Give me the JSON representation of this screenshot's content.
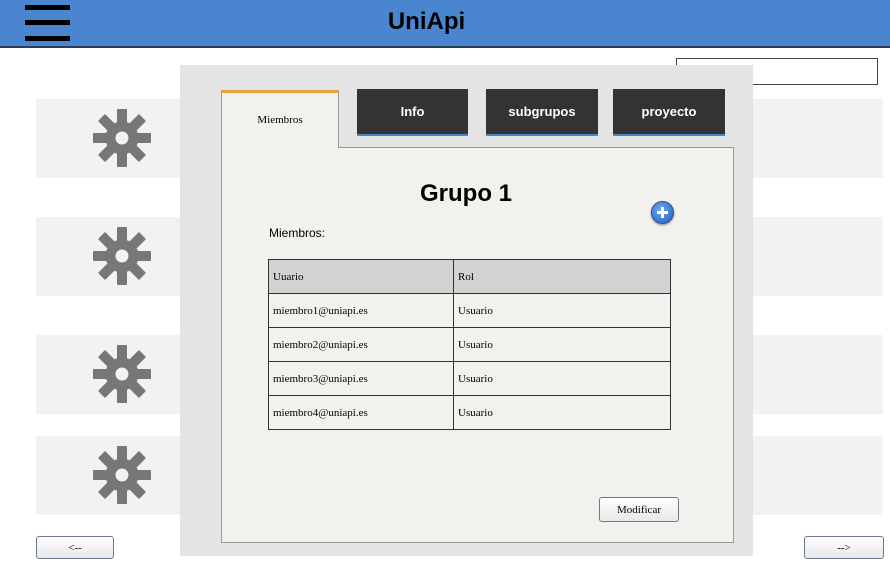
{
  "header": {
    "title": "UniApi",
    "menu_icon": "hamburger-icon"
  },
  "list": {
    "icon": "gear-icon",
    "item_count": 4
  },
  "pagination": {
    "prev_label": "<--",
    "next_label": "-->"
  },
  "modal": {
    "tabs": [
      {
        "label": "Miembros",
        "active": true
      },
      {
        "label": "Info",
        "active": false
      },
      {
        "label": "subgrupos",
        "active": false
      },
      {
        "label": "proyecto",
        "active": false
      }
    ],
    "group_title": "Grupo 1",
    "add_icon": "plus-circle-icon",
    "members_label": "Miembros:",
    "table": {
      "headers": [
        "Uuario",
        "Rol"
      ],
      "rows": [
        [
          "miembro1@uniapi.es",
          "Usuario"
        ],
        [
          "miembro2@uniapi.es",
          "Usuario"
        ],
        [
          "miembro3@uniapi.es",
          "Usuario"
        ],
        [
          "miembro4@uniapi.es",
          "Usuario"
        ]
      ]
    },
    "modify_label": "Modificar"
  },
  "colors": {
    "header_bg": "#4a86d0",
    "tab_bg": "#333333",
    "active_tab_accent": "#e8a33c",
    "panel_bg": "#f2f1ee"
  }
}
